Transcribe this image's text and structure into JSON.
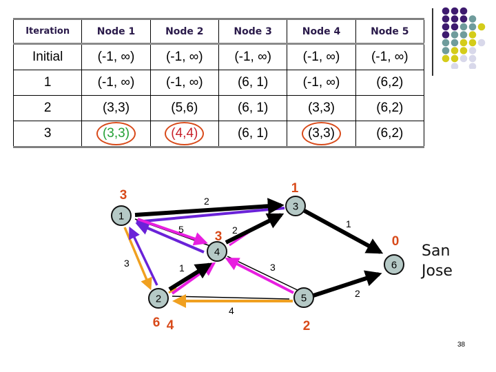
{
  "table": {
    "headers": [
      "Iteration",
      "Node 1",
      "Node 2",
      "Node 3",
      "Node 4",
      "Node 5"
    ],
    "rows": [
      [
        "Initial",
        "(-1, ∞)",
        "(-1, ∞)",
        "(-1, ∞)",
        "(-1, ∞)",
        "(-1, ∞)"
      ],
      [
        "1",
        "(-1, ∞)",
        "(-1, ∞)",
        "(6, 1)",
        "(-1, ∞)",
        "(6,2)"
      ],
      [
        "2",
        "(3,3)",
        "(5,6)",
        "(6, 1)",
        "(3,3)",
        "(6,2)"
      ],
      [
        "3",
        "(3,3)",
        "(4,4)",
        "(6, 1)",
        "(3,3)",
        "(6,2)"
      ]
    ],
    "circled_cells": [
      {
        "row": 3,
        "col": 1,
        "text_color": "#22a033"
      },
      {
        "row": 3,
        "col": 2,
        "text_color": "#c8202a"
      },
      {
        "row": 3,
        "col": 4,
        "text_color": "#000000"
      }
    ],
    "circle_color": "#d84a1a"
  },
  "graph": {
    "nodes": [
      {
        "id": "1",
        "label": "1",
        "distance_labels": [
          "3"
        ]
      },
      {
        "id": "2",
        "label": "2",
        "distance_labels": [
          "6",
          "4"
        ]
      },
      {
        "id": "3",
        "label": "3",
        "distance_labels": [
          "1"
        ]
      },
      {
        "id": "4",
        "label": "4",
        "distance_labels": [
          "3"
        ]
      },
      {
        "id": "5",
        "label": "5",
        "distance_labels": [
          "2"
        ]
      },
      {
        "id": "6",
        "label": "6",
        "distance_labels": [
          "0"
        ]
      }
    ],
    "edges": [
      {
        "from": "1",
        "to": "3",
        "weight": "2"
      },
      {
        "from": "1",
        "to": "4",
        "weight": "5"
      },
      {
        "from": "1",
        "to": "2",
        "weight": "3"
      },
      {
        "from": "2",
        "to": "4",
        "weight": "1"
      },
      {
        "from": "4",
        "to": "3",
        "weight": "2"
      },
      {
        "from": "4",
        "to": "5",
        "weight": "3"
      },
      {
        "from": "5",
        "to": "2",
        "weight": "4"
      },
      {
        "from": "3",
        "to": "6",
        "weight": "1"
      },
      {
        "from": "5",
        "to": "6",
        "weight": "2"
      }
    ],
    "destination_label": [
      "San",
      "Jose"
    ],
    "colors": {
      "node_fill": "#b5c9c6",
      "distance_label": "#d84a1a",
      "black_path": "#000000",
      "purple_path": "#6a22d8",
      "magenta_path": "#e81ee0",
      "orange_path": "#f0a020"
    }
  },
  "decoration": {
    "dot_colors": [
      "#3d1a6e",
      "#6f9c9c",
      "#d4cc1a",
      "#d8d8ea"
    ]
  },
  "slide_number": "38"
}
